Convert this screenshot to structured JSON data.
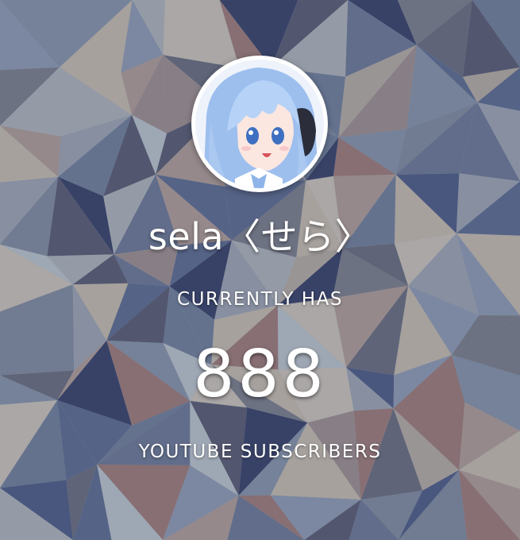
{
  "channel": {
    "name": "sela〈せら〉",
    "avatar_icon": "anime-girl-avatar-icon"
  },
  "stats": {
    "top_caption": "CURRENTLY HAS",
    "count": "888",
    "bottom_caption": "YOUTUBE SUBSCRIBERS"
  },
  "colors": {
    "text": "#ffffff",
    "avatar_hair": "#a9c8f2",
    "background_base": "#7f8797"
  }
}
